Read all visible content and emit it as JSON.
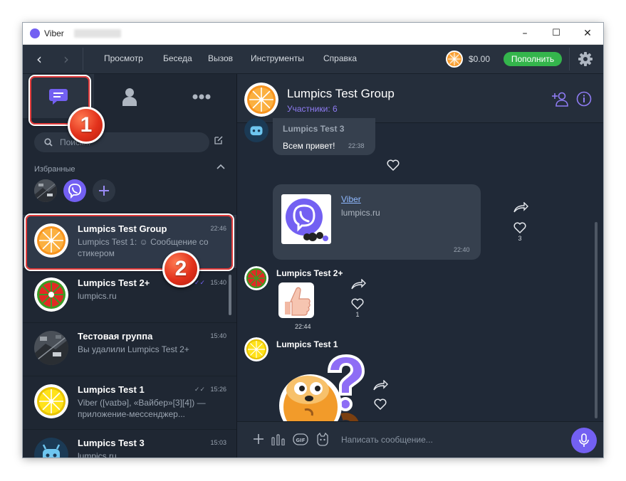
{
  "window": {
    "app_title": "Viber",
    "minimize": "–",
    "maximize": "☐",
    "close": "✕"
  },
  "toolbar": {
    "back": "‹",
    "forward": "›",
    "menu": [
      "Просмотр",
      "Беседа",
      "Вызов",
      "Инструменты",
      "Справка"
    ],
    "balance": "$0.00",
    "topup_label": "Пополнить"
  },
  "sidebar": {
    "tabs": [
      {
        "icon": "chats-icon",
        "active": true
      },
      {
        "icon": "contacts-icon",
        "active": false
      },
      {
        "icon": "more-icon",
        "active": false
      }
    ],
    "search_placeholder": "Поиск...",
    "favorites_label": "Избранные",
    "favorites": [
      {
        "icon": "favorite-photo-avatar"
      },
      {
        "icon": "viber-icon"
      },
      {
        "icon": "add-icon"
      }
    ],
    "chats": [
      {
        "name": "Lumpics Test Group",
        "time": "22:46",
        "preview": "Lumpics Test 1: ☺ Сообщение со стикером",
        "ticks": "",
        "selected": true,
        "avatar": "orange"
      },
      {
        "name": "Lumpics Test 2+",
        "time": "15:40",
        "preview": "lumpics.ru",
        "ticks": "✓✓",
        "ticks_read": true,
        "avatar": "lime"
      },
      {
        "name": "Тестовая группа",
        "time": "15:40",
        "preview": "Вы удалили Lumpics Test 2+",
        "ticks": "",
        "avatar": "photo"
      },
      {
        "name": "Lumpics Test 1",
        "time": "15:26",
        "preview": "Viber ([vaɪbə], «Вайбер»[3][4]) — приложение-мессенджер...",
        "ticks": "✓✓",
        "ticks_read": false,
        "avatar": "lemon"
      },
      {
        "name": "Lumpics Test 3",
        "time": "15:03",
        "preview": "lumpics.ru",
        "ticks": "",
        "avatar": "robot"
      }
    ]
  },
  "conversation": {
    "title": "Lumpics Test Group",
    "subtitle": "Участники: 6",
    "messages": [
      {
        "sender": "Lumpics Test 3",
        "text": "Всем привет!",
        "time": "22:38"
      },
      {
        "link_title": "Viber",
        "link_domain": "lumpics.ru",
        "time": "22:40",
        "likes": "3"
      },
      {
        "sender": "Lumpics Test 2+",
        "time": "22:44",
        "likes": "1"
      },
      {
        "sender": "Lumpics Test 1"
      }
    ],
    "input_placeholder": "Написать сообщение..."
  },
  "callouts": {
    "one": "1",
    "two": "2"
  },
  "colors": {
    "accent": "#7360f2",
    "topup_green": "#34b54c",
    "callout_red": "#e23a3a"
  }
}
